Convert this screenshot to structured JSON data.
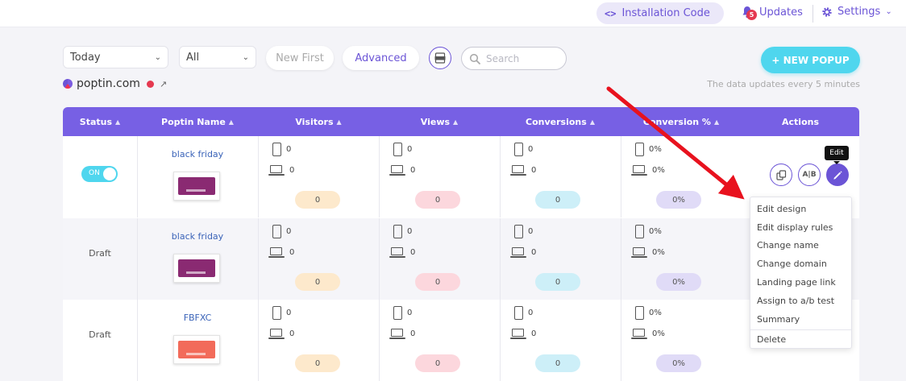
{
  "topbar": {
    "installation_code": "Installation Code",
    "updates_label": "Updates",
    "updates_count": "5",
    "settings_label": "Settings"
  },
  "toolbar": {
    "date_filter": "Today",
    "type_filter": "All",
    "sort_button": "New First",
    "advanced_button": "Advanced",
    "search_placeholder": "Search",
    "new_popup_button": "+ NEW POPUP"
  },
  "site": {
    "domain": "poptin.com",
    "update_note": "The data updates every 5 minutes"
  },
  "table": {
    "headers": [
      "Status",
      "Poptin Name",
      "Visitors",
      "Views",
      "Conversions",
      "Conversion %",
      "Actions"
    ],
    "rows": [
      {
        "status": "ON",
        "name": "black friday",
        "thumb_color": "#8a2a72",
        "visitors": {
          "mobile": "0",
          "desktop": "0",
          "total": "0"
        },
        "views": {
          "mobile": "0",
          "desktop": "0",
          "total": "0"
        },
        "conversions": {
          "mobile": "0",
          "desktop": "0",
          "total": "0"
        },
        "conversion_pct": {
          "mobile": "0%",
          "desktop": "0%",
          "total": "0%"
        }
      },
      {
        "status": "Draft",
        "name": "black friday",
        "thumb_color": "#8a2a72",
        "visitors": {
          "mobile": "0",
          "desktop": "0",
          "total": "0"
        },
        "views": {
          "mobile": "0",
          "desktop": "0",
          "total": "0"
        },
        "conversions": {
          "mobile": "0",
          "desktop": "0",
          "total": "0"
        },
        "conversion_pct": {
          "mobile": "0%",
          "desktop": "0%",
          "total": "0%"
        }
      },
      {
        "status": "Draft",
        "name": "FBFXC",
        "thumb_color": "#f26b5a",
        "visitors": {
          "mobile": "0",
          "desktop": "0",
          "total": "0"
        },
        "views": {
          "mobile": "0",
          "desktop": "0",
          "total": "0"
        },
        "conversions": {
          "mobile": "0",
          "desktop": "0",
          "total": "0"
        },
        "conversion_pct": {
          "mobile": "0%",
          "desktop": "0%",
          "total": "0%"
        }
      }
    ],
    "ab_label": "A|B"
  },
  "tooltip": "Edit",
  "menu": {
    "items": [
      "Edit design",
      "Edit display rules",
      "Change name",
      "Change domain",
      "Landing page link",
      "Assign to a/b test",
      "Summary"
    ],
    "delete": "Delete"
  },
  "colors": {
    "accent": "#6b54d6",
    "header": "#7760e4",
    "cyan": "#4fd6ee",
    "arrow": "#e8121e"
  }
}
